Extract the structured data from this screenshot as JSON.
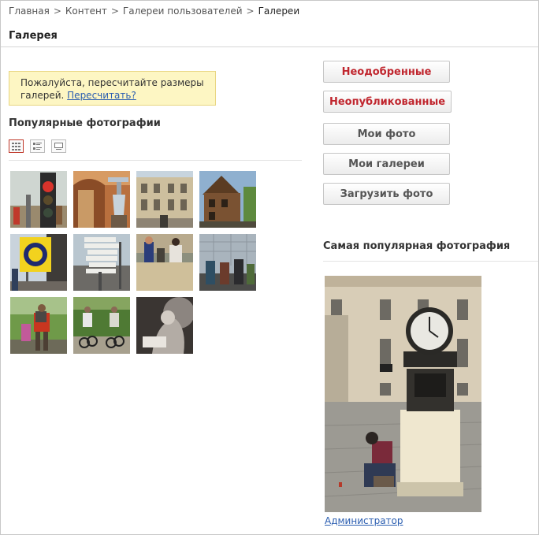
{
  "breadcrumb": {
    "items": [
      "Главная",
      "Контент",
      "Галереи пользователей"
    ],
    "separator": ">",
    "current": "Галереи"
  },
  "page": {
    "title": "Галерея"
  },
  "notice": {
    "text": "Пожалуйста, пересчитайте размеры галерей.",
    "link": "Пересчитать?"
  },
  "popular": {
    "title": "Популярные фотографии"
  },
  "view_modes": [
    "grid-large-icon",
    "grid-small-icon",
    "list-icon"
  ],
  "thumbnails": [
    "traffic-light-photo",
    "lantern-photo",
    "building-photo",
    "wooden-house-photo",
    "sign-photo",
    "signpost-photo",
    "people-on-wall-photo",
    "tourists-photo",
    "hiker-photo",
    "cyclists-photo",
    "sepia-photo"
  ],
  "buttons": {
    "unapproved": "Неодобренные",
    "unpublished": "Неопубликованные",
    "my_photos": "Мои фото",
    "my_galleries": "Мои галереи",
    "upload": "Загрузить фото"
  },
  "most_popular": {
    "title": "Самая популярная фотография",
    "author": "Администратор"
  },
  "colors": {
    "accent_red": "#c0262e",
    "link_blue": "#2a5db0",
    "notice_bg": "#fdf6c3"
  }
}
